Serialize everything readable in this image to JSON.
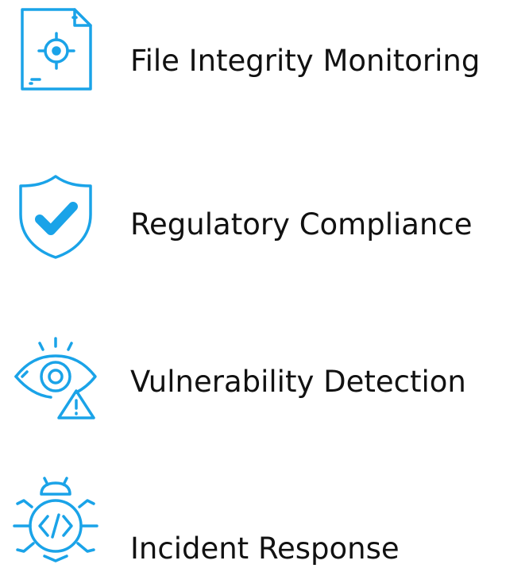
{
  "colors": {
    "accent": "#1aa3e8",
    "text": "#111111",
    "background": "#ffffff"
  },
  "features": [
    {
      "icon": "file-target-icon",
      "label": "File Integrity Monitoring"
    },
    {
      "icon": "shield-check-icon",
      "label": "Regulatory Compliance"
    },
    {
      "icon": "eye-warning-icon",
      "label": "Vulnerability Detection"
    },
    {
      "icon": "bug-code-icon",
      "label": "Incident Response"
    }
  ]
}
